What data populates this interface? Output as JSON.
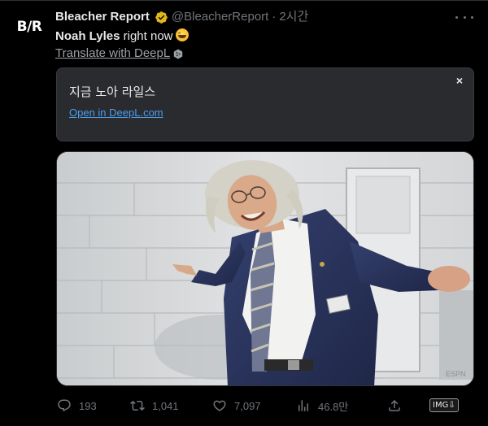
{
  "author": {
    "logo_text": "B/R",
    "display_name": "Bleacher Report",
    "handle": "@BleacherReport",
    "separator": "·",
    "time": "2시간"
  },
  "tweet": {
    "name_bold": "Noah Lyles",
    "text_rest": " right now",
    "emoji": "grinning-sweat-emoji"
  },
  "translate": {
    "link_label": "Translate with DeepL"
  },
  "deepl": {
    "translation": "지금 노아 라일스",
    "open_label": "Open in DeepL.com",
    "close_label": "×"
  },
  "media": {
    "watermark": "ESPN"
  },
  "actions": {
    "replies": "193",
    "retweets": "1,041",
    "likes": "7,097",
    "views": "46.8만",
    "img_badge": "IMG"
  },
  "colors": {
    "background": "#000000",
    "text": "#e7e9ea",
    "muted": "#71767b",
    "verified": "#e2b719",
    "link": "#4a9eef",
    "panel": "#2a2b2e"
  }
}
